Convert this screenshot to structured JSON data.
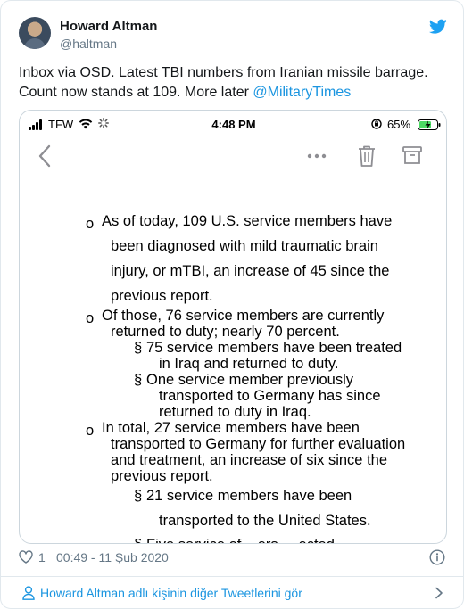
{
  "author": {
    "name": "Howard Altman",
    "handle": "@haltman"
  },
  "tweet": {
    "text": "Inbox via OSD. Latest TBI numbers from Iranian missile barrage. Count now stands at 109. More later ",
    "mention": "@MilitaryTimes"
  },
  "phone": {
    "carrier": "TFW",
    "time": "4:48 PM",
    "battery": "65%"
  },
  "document": {
    "bullet_o": "o",
    "bullet_s": "§",
    "lines": [
      "As of today, 109 U.S. service members have",
      "been diagnosed with mild traumatic brain",
      "injury, or mTBI, an increase of 45 since the",
      "previous report.",
      "Of those, 76 service members are currently",
      "returned to duty; nearly 70 percent.",
      "75 service members have been treated",
      "in Iraq and returned to duty.",
      "One service member previously",
      "transported to Germany has since",
      "returned to duty in Iraq.",
      "In total, 27 service members have been",
      "transported to Germany for further evaluation",
      "and treatment, an increase of six since the",
      "previous report.",
      "21 service members have been",
      "transported to the United States.",
      "Five service of ...ers ... ected"
    ]
  },
  "footer": {
    "likes": "1",
    "timestamp": "00:49 - 11 Şub 2020",
    "more_tweets": "Howard Altman adlı kişinin diğer Tweetlerini gör"
  },
  "colors": {
    "link": "#1b95e0",
    "secondary_text": "#657786",
    "battery_green": "#4cd964"
  }
}
